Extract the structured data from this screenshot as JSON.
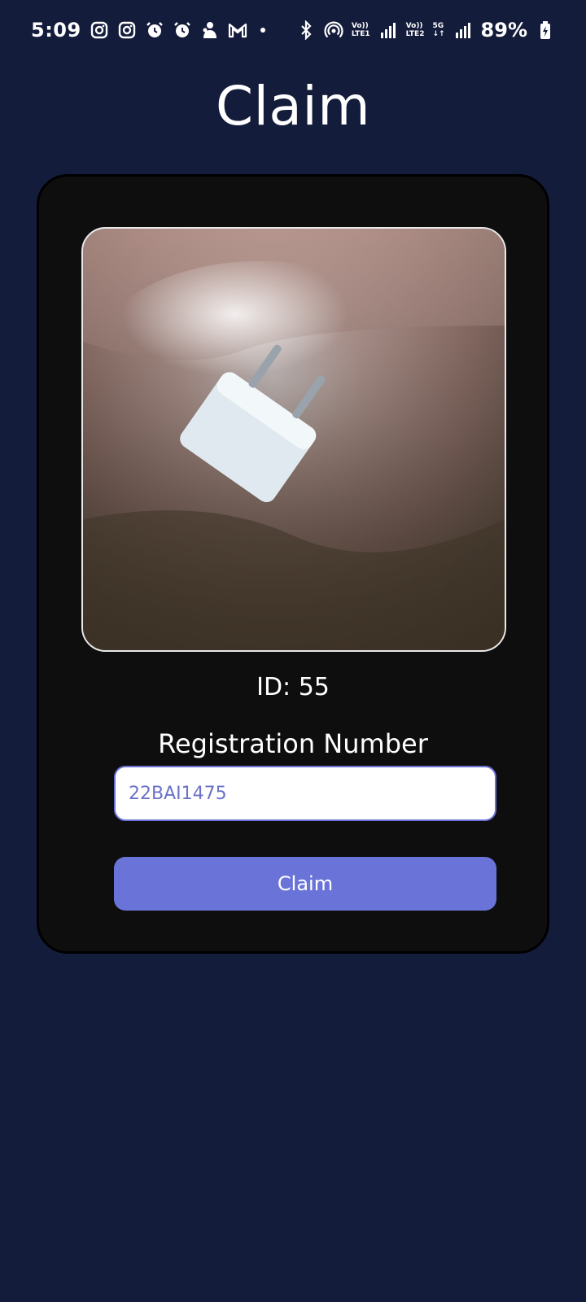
{
  "status_bar": {
    "time": "5:09",
    "left_icons": [
      "instagram-icon",
      "instagram-icon",
      "alarm-icon",
      "alarm-icon",
      "notification-app-icon",
      "gmail-icon"
    ],
    "net1": {
      "top": "Vo))",
      "bottom": "LTE1"
    },
    "net2": {
      "top": "Vo))",
      "bottom": "LTE2"
    },
    "net2_badge": "5G",
    "battery": "89%"
  },
  "page": {
    "title": "Claim"
  },
  "item": {
    "image_icon": "charger-photo",
    "id_text": "ID: 55"
  },
  "form": {
    "reg_label": "Registration Number",
    "reg_value": "22BAI1475",
    "button_label": "Claim"
  },
  "colors": {
    "background": "#141c3b",
    "card": "#0e0e0e",
    "accent": "#6a74d8"
  }
}
